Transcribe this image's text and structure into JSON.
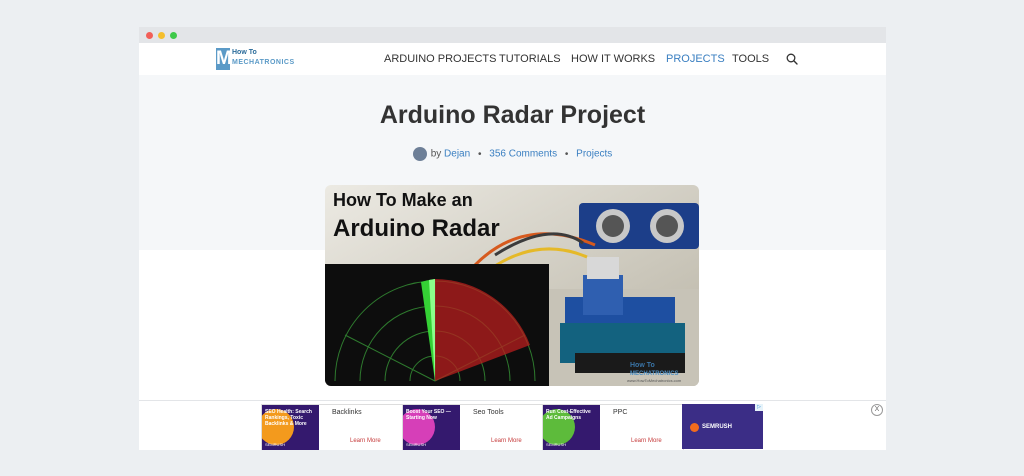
{
  "logo": {
    "top_text": "How To",
    "bottom_text": "MECHATRONICS"
  },
  "nav": {
    "items": [
      "ARDUINO PROJECTS",
      "TUTORIALS",
      "HOW IT WORKS",
      "PROJECTS",
      "TOOLS"
    ],
    "active": "PROJECTS"
  },
  "article": {
    "title": "Arduino Radar Project",
    "by": "by",
    "author": "Dejan",
    "comments": "356 Comments",
    "category": "Projects",
    "separator": "•"
  },
  "featured_image": {
    "line1": "How To Make an",
    "line2": "Arduino Radar",
    "watermark_top": "How To",
    "watermark_bottom": "MECHATRONICS",
    "watermark_url": "www.HowToMechatronics.com"
  },
  "ads": {
    "close": "X",
    "items": [
      {
        "image_text": "SEO Health: Search Rankings, Toxic Backlinks & More",
        "brand": "SEMRUSH",
        "title": "Backlinks",
        "cta": "Learn More",
        "color": "#f39a1d"
      },
      {
        "image_text": "Boost Your SEO — Starting Now",
        "brand": "SEMRUSH",
        "title": "Seo Tools",
        "cta": "Learn More",
        "color": "#d63fb8"
      },
      {
        "image_text": "Run Cost-Effective Ad Campaigns",
        "brand": "SEMRUSH",
        "title": "PPC",
        "cta": "Learn More",
        "color": "#5dbb3b"
      }
    ],
    "semrush_label": "SEMRUSH",
    "adchoice": "▷"
  }
}
